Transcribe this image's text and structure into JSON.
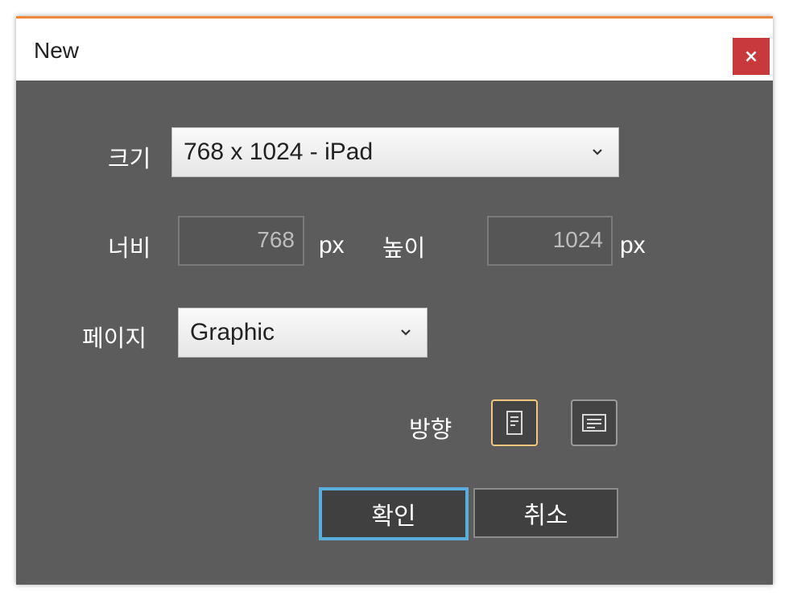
{
  "dialog": {
    "title": "New",
    "close_label": "×"
  },
  "size": {
    "label": "크기",
    "selected": "768 x 1024 - iPad"
  },
  "width": {
    "label": "너비",
    "value": "768",
    "unit": "px"
  },
  "height": {
    "label": "높이",
    "value": "1024",
    "unit": "px"
  },
  "page": {
    "label": "페이지",
    "selected": "Graphic"
  },
  "orientation": {
    "label": "방향",
    "portrait_icon": "portrait-page-icon",
    "landscape_icon": "landscape-page-icon",
    "selected": "portrait"
  },
  "buttons": {
    "ok_label": "확인",
    "cancel_label": "취소"
  },
  "colors": {
    "accent_top_border": "#f0883c",
    "close_button": "#c8393c",
    "focus_ring": "#5aaedc",
    "selected_orientation_border": "#f1c67e",
    "dialog_body": "#5c5c5c"
  }
}
